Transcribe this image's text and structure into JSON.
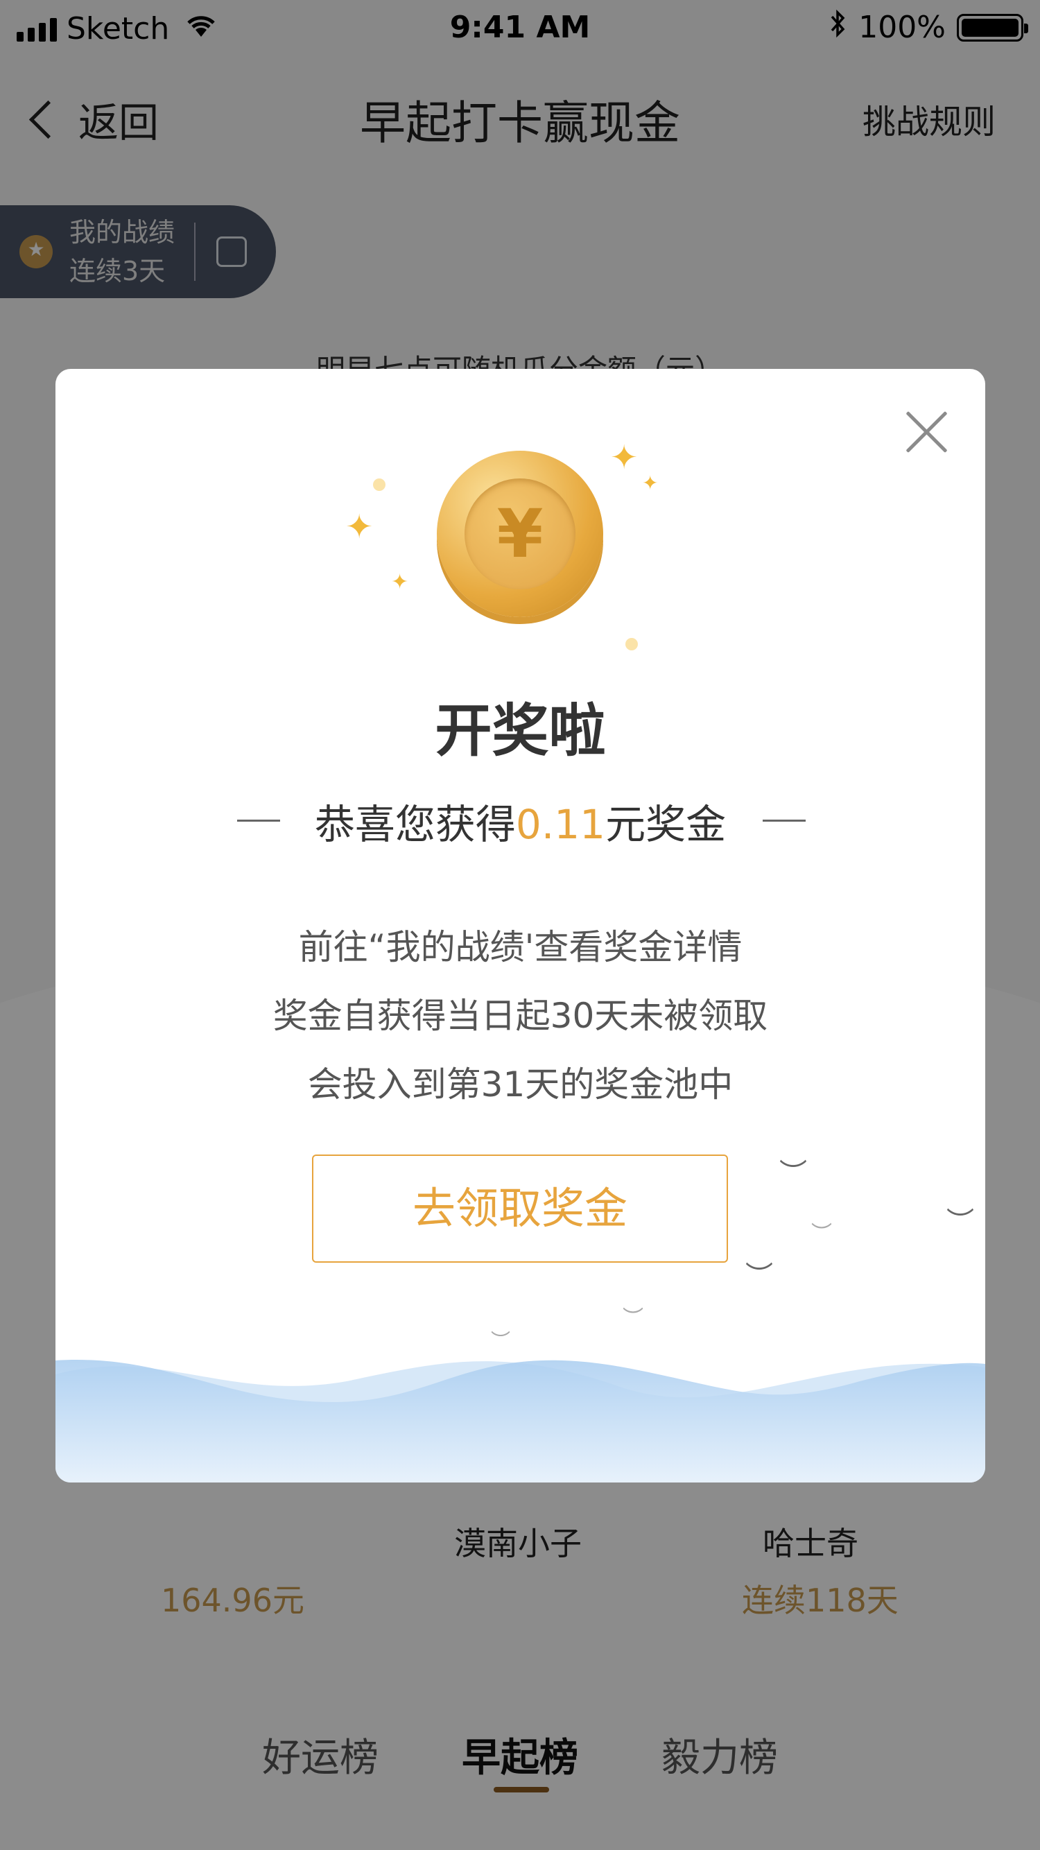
{
  "status_bar": {
    "carrier": "Sketch",
    "time": "9:41 AM",
    "battery": "100%"
  },
  "nav": {
    "back_label": "返回",
    "title": "早起打卡赢现金",
    "rules_label": "挑战规则"
  },
  "record": {
    "line1": "我的战绩",
    "line2": "连续3天"
  },
  "background_hint": "明早七点可随机瓜分金额（元）",
  "ranking_peek": {
    "amount": "164.96元",
    "name_center": "漠南小子",
    "name_right": "哈士奇",
    "streak_right": "连续118天"
  },
  "tabs": [
    {
      "label": "好运榜",
      "active": false
    },
    {
      "label": "早起榜",
      "active": true
    },
    {
      "label": "毅力榜",
      "active": false
    }
  ],
  "modal": {
    "coin_symbol": "¥",
    "title": "开奖啦",
    "congrats_prefix": "恭喜您获得",
    "amount": "0.11",
    "congrats_suffix": "元奖金",
    "body_line1": "前往“我的战绩'查看奖金详情",
    "body_line2": "奖金自获得当日起30天未被领取",
    "body_line3": "会投入到第31天的奖金池中",
    "button_label": "去领取奖金"
  },
  "colors": {
    "accent": "#e7a43d",
    "pill_bg": "#4b5466",
    "wave": "#a9cdf0"
  }
}
